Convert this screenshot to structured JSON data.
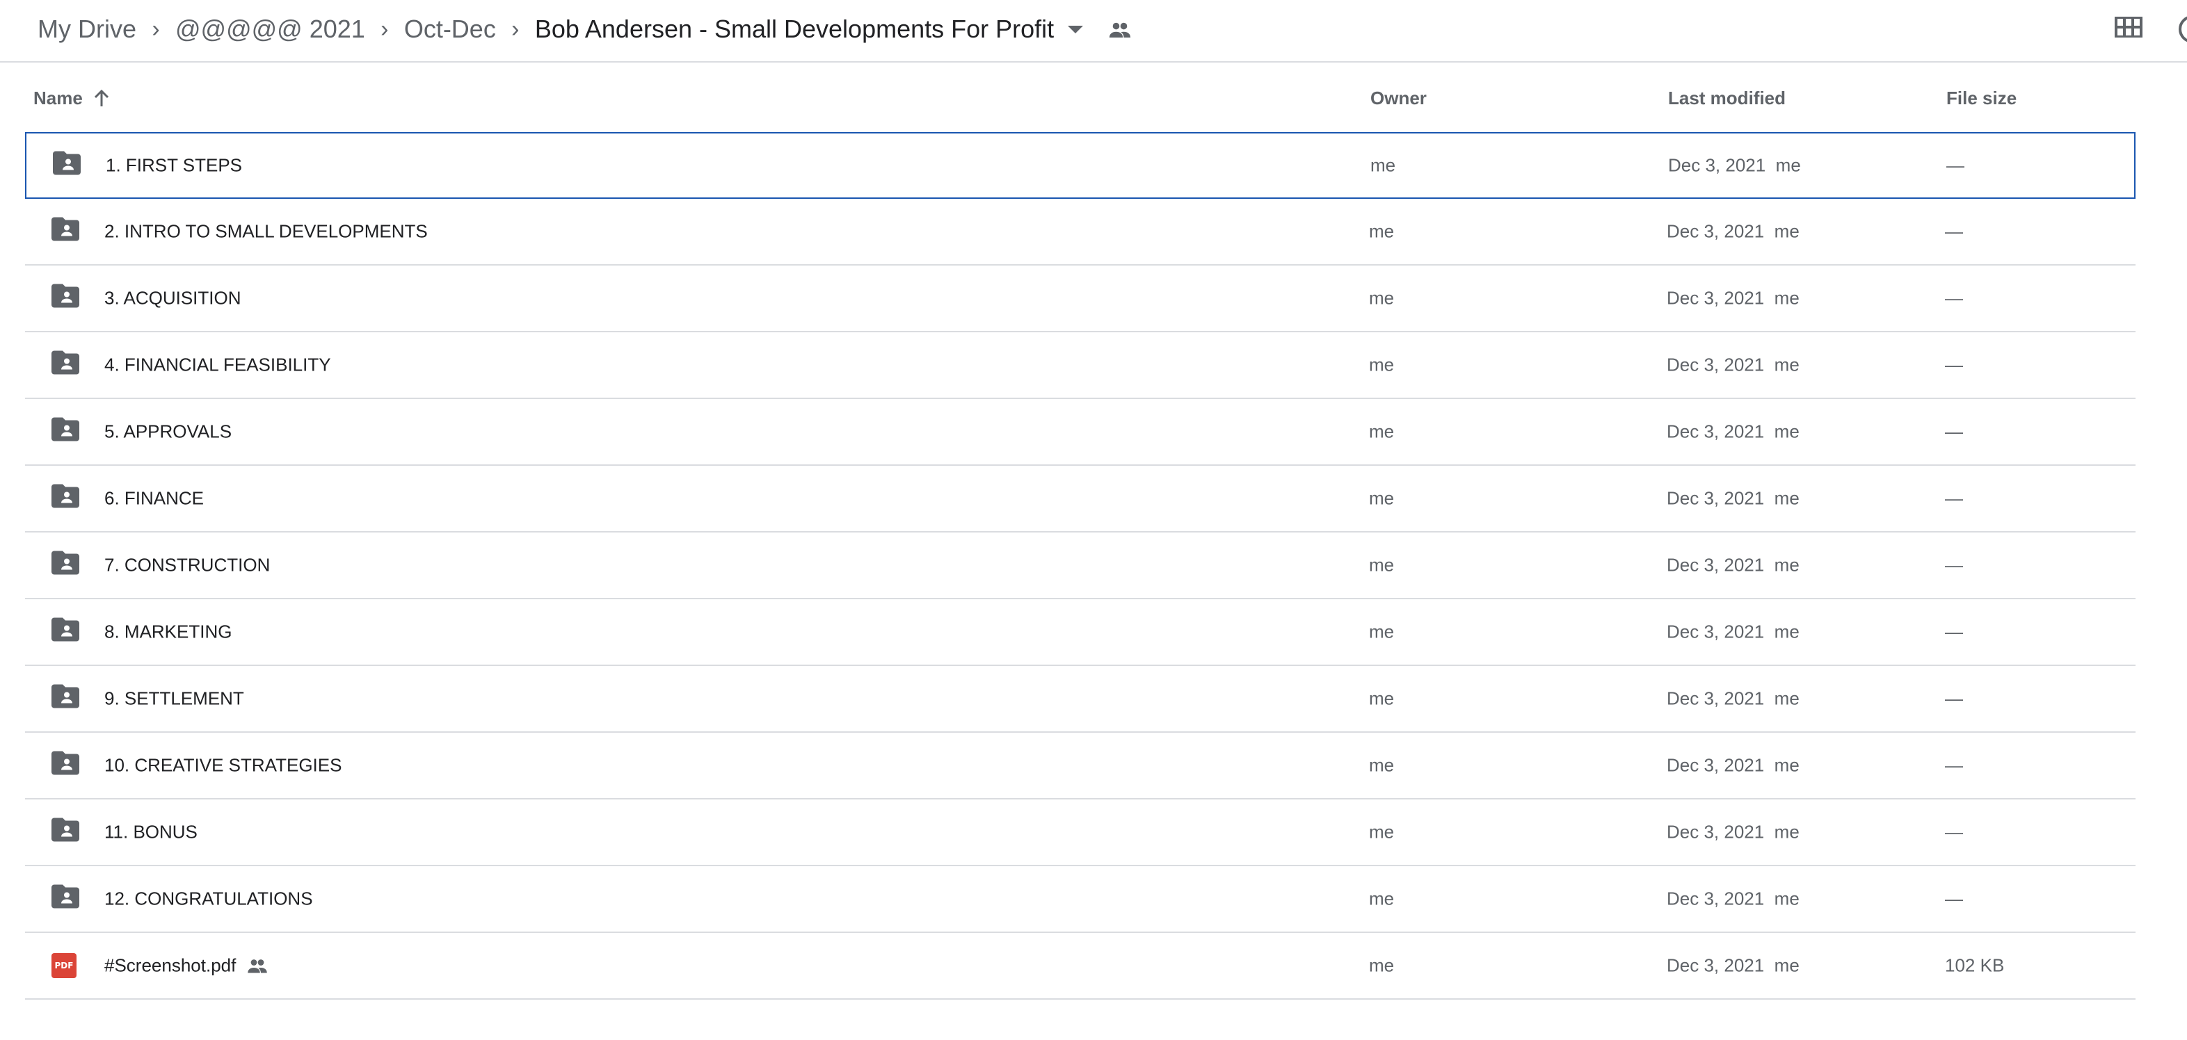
{
  "breadcrumb": {
    "items": [
      "My Drive",
      "@@@@@ 2021",
      "Oct-Dec"
    ],
    "current": "Bob Andersen - Small Developments For Profit",
    "separator": "›"
  },
  "icons": {
    "folder": "shared-folder-icon",
    "pdf": "pdf-icon",
    "shared": "people-icon",
    "grid": "grid-view-icon",
    "info": "info-icon",
    "sort": "arrow-up-icon"
  },
  "columns": {
    "name": "Name",
    "owner": "Owner",
    "modified": "Last modified",
    "size": "File size"
  },
  "colors": {
    "selection": "#1a56b0",
    "pdf": "#db4437",
    "icon": "#5f6368"
  },
  "rows": [
    {
      "name": "1. FIRST STEPS",
      "type": "folder",
      "owner": "me",
      "modified": "Dec 3, 2021",
      "modified_by": "me",
      "size": "—",
      "selected": true
    },
    {
      "name": "2. INTRO TO SMALL DEVELOPMENTS",
      "type": "folder",
      "owner": "me",
      "modified": "Dec 3, 2021",
      "modified_by": "me",
      "size": "—"
    },
    {
      "name": "3. ACQUISITION",
      "type": "folder",
      "owner": "me",
      "modified": "Dec 3, 2021",
      "modified_by": "me",
      "size": "—"
    },
    {
      "name": "4. FINANCIAL FEASIBILITY",
      "type": "folder",
      "owner": "me",
      "modified": "Dec 3, 2021",
      "modified_by": "me",
      "size": "—"
    },
    {
      "name": "5. APPROVALS",
      "type": "folder",
      "owner": "me",
      "modified": "Dec 3, 2021",
      "modified_by": "me",
      "size": "—"
    },
    {
      "name": "6. FINANCE",
      "type": "folder",
      "owner": "me",
      "modified": "Dec 3, 2021",
      "modified_by": "me",
      "size": "—"
    },
    {
      "name": "7. CONSTRUCTION",
      "type": "folder",
      "owner": "me",
      "modified": "Dec 3, 2021",
      "modified_by": "me",
      "size": "—"
    },
    {
      "name": "8. MARKETING",
      "type": "folder",
      "owner": "me",
      "modified": "Dec 3, 2021",
      "modified_by": "me",
      "size": "—"
    },
    {
      "name": "9. SETTLEMENT",
      "type": "folder",
      "owner": "me",
      "modified": "Dec 3, 2021",
      "modified_by": "me",
      "size": "—"
    },
    {
      "name": "10. CREATIVE STRATEGIES",
      "type": "folder",
      "owner": "me",
      "modified": "Dec 3, 2021",
      "modified_by": "me",
      "size": "—"
    },
    {
      "name": "11. BONUS",
      "type": "folder",
      "owner": "me",
      "modified": "Dec 3, 2021",
      "modified_by": "me",
      "size": "—"
    },
    {
      "name": "12. CONGRATULATIONS",
      "type": "folder",
      "owner": "me",
      "modified": "Dec 3, 2021",
      "modified_by": "me",
      "size": "—"
    },
    {
      "name": "#Screenshot.pdf",
      "type": "pdf",
      "icon_text": "PDF",
      "shared": true,
      "owner": "me",
      "modified": "Dec 3, 2021",
      "modified_by": "me",
      "size": "102 KB"
    }
  ]
}
